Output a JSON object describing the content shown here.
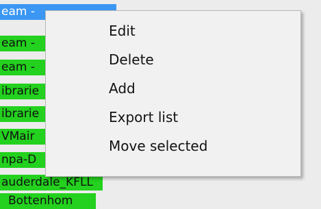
{
  "list": {
    "items": [
      {
        "label": "eam -",
        "selected": true
      },
      {
        "label": "eam -",
        "selected": false
      },
      {
        "label": "eam -",
        "selected": false
      },
      {
        "label": "ibrarie",
        "selected": false
      },
      {
        "label": "ibrarie",
        "selected": false
      },
      {
        "label": "VMair",
        "selected": false
      },
      {
        "label": "npa-D",
        "selected": false
      },
      {
        "label": "auderdale_KFLL",
        "selected": false
      },
      {
        "label": "Bottenhom",
        "selected": false
      }
    ]
  },
  "context_menu": {
    "items": [
      {
        "label": "Edit"
      },
      {
        "label": "Delete"
      },
      {
        "label": "Add"
      },
      {
        "label": "Export list"
      },
      {
        "label": "Move selected"
      }
    ]
  },
  "colors": {
    "selected_row": "#3b97f3",
    "list_row": "#23d11e",
    "menu_background": "#f1f1f1"
  }
}
